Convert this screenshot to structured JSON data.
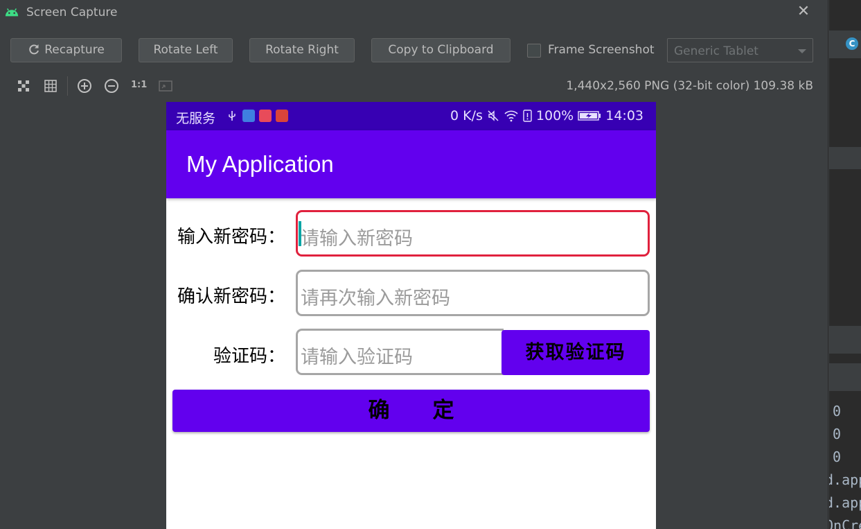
{
  "window": {
    "title": "Screen Capture",
    "close_glyph": "✕"
  },
  "toolbar": {
    "recapture_label": "Recapture",
    "rotate_left_label": "Rotate Left",
    "rotate_right_label": "Rotate Right",
    "copy_label": "Copy to Clipboard",
    "frame_screenshot_label": "Frame Screenshot",
    "frame_screenshot_checked": false,
    "device_select_value": "Generic Tablet"
  },
  "zoom_toolbar": {
    "actual_size_label": "1:1",
    "image_info": "1,440x2,560 PNG (32-bit color) 109.38 kB"
  },
  "phone": {
    "status_bar": {
      "carrier": "无服务",
      "network_speed": "0 K/s",
      "battery": "100%",
      "time": "14:03"
    },
    "app_title": "My Application",
    "form": {
      "new_password_label": "输入新密码：",
      "new_password_placeholder": "请输入新密码",
      "confirm_password_label": "确认新密码：",
      "confirm_password_placeholder": "请再次输入新密码",
      "code_label": "验证码：",
      "code_placeholder": "请输入验证码",
      "get_code_label": "获取验证码",
      "confirm_label": "确　　定"
    }
  },
  "ide": {
    "badge": "C",
    "lines": [
      "0",
      "0",
      "0",
      "d.app",
      "d.app",
      "OnCre"
    ]
  },
  "colors": {
    "primary": "#6200ee",
    "primary_dark": "#3700b3",
    "focus_border": "#e0213d",
    "dialog_bg": "#3c3f41"
  }
}
